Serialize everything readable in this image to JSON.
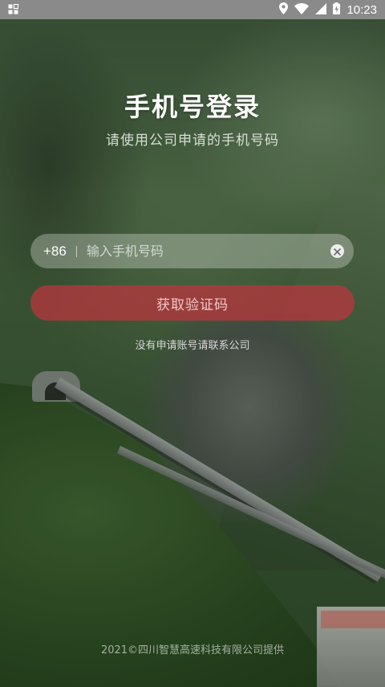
{
  "status_bar": {
    "time": "10:23",
    "icons": [
      "app-notification-icon",
      "location-icon",
      "wifi-icon",
      "cellular-signal-icon",
      "battery-icon"
    ]
  },
  "login": {
    "title": "手机号登录",
    "subtitle": "请使用公司申请的手机号码",
    "country_code": "+86",
    "phone_placeholder": "输入手机号码",
    "phone_value": "",
    "clear_icon": "close-icon",
    "get_code_label": "获取验证码",
    "contact_text": "没有申请账号请联系公司"
  },
  "footer": {
    "text": "2021©四川智慧高速科技有限公司提供"
  },
  "colors": {
    "status_bar_bg": "#8a8a8a",
    "primary_button": "#be343e",
    "text_white": "#ffffff"
  }
}
